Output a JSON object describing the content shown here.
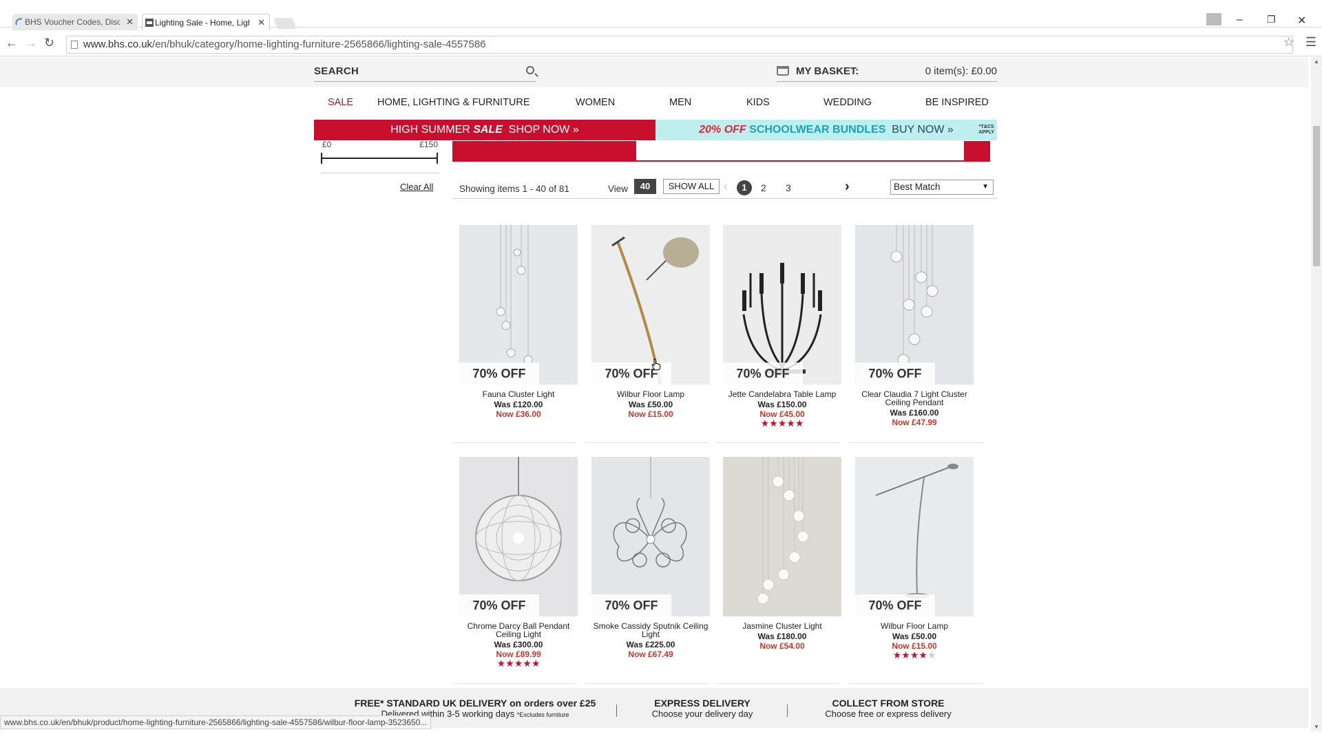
{
  "browser": {
    "tabs": [
      {
        "title": "BHS Voucher Codes, Disc",
        "close": "✕"
      },
      {
        "title": "Lighting Sale - Home, Ligh",
        "close": "✕"
      }
    ],
    "url_host": "www.bhs.co.uk",
    "url_path": "/en/bhuk/category/home-lighting-furniture-2565866/lighting-sale-4557586",
    "status_url": "www.bhs.co.uk/en/bhuk/product/home-lighting-furniture-2565866/lighting-sale-4557586/wilbur-floor-lamp-3523650..."
  },
  "header": {
    "search_label": "SEARCH",
    "basket_label": "MY BASKET:",
    "basket_value": "0 item(s): £0.00"
  },
  "nav": [
    "SALE",
    "HOME, LIGHTING & FURNITURE",
    "WOMEN",
    "MEN",
    "KIDS",
    "WEDDING",
    "BE INSPIRED"
  ],
  "promo": {
    "left_a": "HIGH SUMMER ",
    "left_b": "SALE",
    "left_c": "SHOP NOW »",
    "right_pct": "20% OFF",
    "right_text": "SCHOOLWEAR BUNDLES",
    "right_buy": "BUY NOW »",
    "tacs_1": "*T&CS",
    "tacs_2": "APPLY"
  },
  "filter": {
    "price_min": "£0",
    "price_max": "£150",
    "clear_all": "Clear All"
  },
  "toolbar": {
    "showing": "Showing items 1 - 40 of 81",
    "view_label": "View",
    "view_count": "40",
    "show_all": "SHOW ALL",
    "pages": [
      "1",
      "2",
      "3"
    ],
    "sort": "Best Match"
  },
  "products": [
    {
      "name": "Fauna Cluster Light",
      "was": "Was £120.00",
      "now": "Now £36.00",
      "badge": "70% OFF",
      "rating": 0
    },
    {
      "name": "Wilbur Floor Lamp",
      "was": "Was £50.00",
      "now": "Now £15.00",
      "badge": "70% OFF",
      "rating": 0
    },
    {
      "name": "Jette Candelabra Table Lamp",
      "was": "Was £150.00",
      "now": "Now £45.00",
      "badge": "70% OFF",
      "rating": 5
    },
    {
      "name": "Clear Claudia 7 Light Cluster Ceiling Pendant",
      "was": "Was £160.00",
      "now": "Now £47.99",
      "badge": "70% OFF",
      "rating": 0
    },
    {
      "name": "Chrome Darcy Ball Pendant Ceiling Light",
      "was": "Was £300.00",
      "now": "Now £89.99",
      "badge": "70% OFF",
      "rating": 5
    },
    {
      "name": "Smoke Cassidy Sputnik Ceiling Light",
      "was": "Was £225.00",
      "now": "Now £67.49",
      "badge": "70% OFF",
      "rating": 0
    },
    {
      "name": "Jasmine Cluster Light",
      "was": "Was £180.00",
      "now": "Now £54.00",
      "badge": "",
      "rating": 0
    },
    {
      "name": "Wilbur Floor Lamp",
      "was": "Was £50.00",
      "now": "Now £15.00",
      "badge": "70% OFF",
      "rating": 4
    }
  ],
  "footer": {
    "delivery_h": "FREE* STANDARD UK DELIVERY on orders over £25",
    "delivery_s": "Delivered within 3-5 working days",
    "delivery_note": "*Excludes furniture",
    "express_h": "EXPRESS DELIVERY",
    "express_s": "Choose your delivery day",
    "collect_h": "COLLECT FROM STORE",
    "collect_s": "Choose free or express delivery"
  },
  "colors": {
    "brand_red": "#c8102e",
    "sale_red": "#9a1c2c",
    "price_red": "#c0392b",
    "promo_teal": "#1aa3b5"
  }
}
